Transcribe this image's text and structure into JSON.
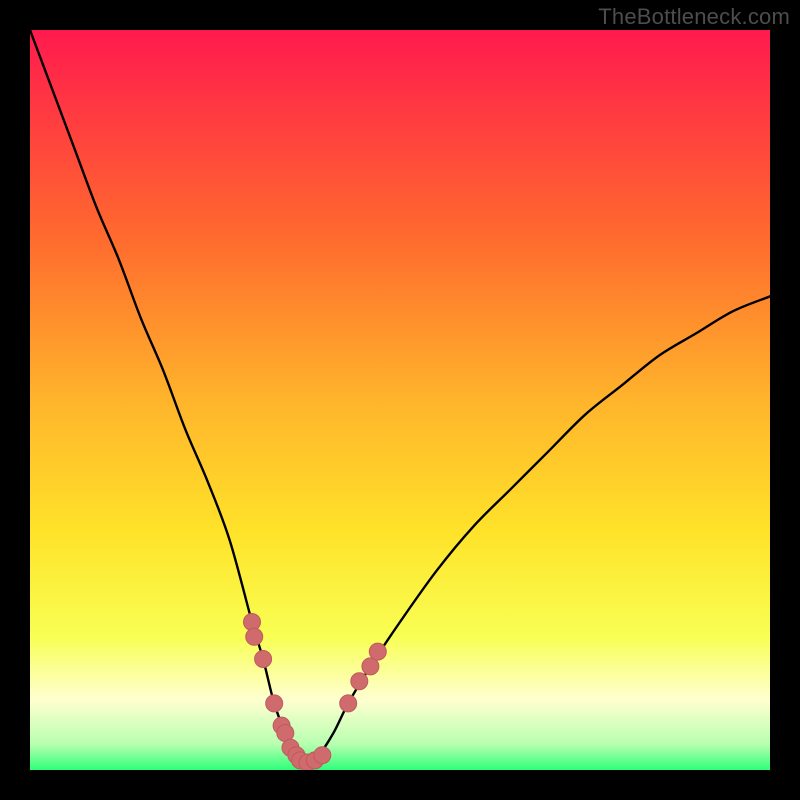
{
  "watermark": "TheBottleneck.com",
  "colors": {
    "bg": "#000000",
    "grad_top": "#ff1a4e",
    "grad_mid1": "#ff6a2e",
    "grad_mid2": "#ffb42b",
    "grad_mid3": "#ffe32a",
    "grad_low": "#f8ff54",
    "grad_pale": "#ffffd0",
    "grad_bottom": "#2fff7a",
    "curve": "#000000",
    "marker_fill": "#cf6a6d",
    "marker_stroke": "#c05a5d"
  },
  "chart_data": {
    "type": "line",
    "title": "",
    "xlabel": "",
    "ylabel": "",
    "xlim": [
      0,
      100
    ],
    "ylim": [
      0,
      100
    ],
    "series": [
      {
        "name": "bottleneck-curve",
        "x": [
          0,
          3,
          6,
          9,
          12,
          15,
          18,
          21,
          24,
          27,
          30,
          31.5,
          33,
          34.5,
          36,
          37.5,
          39,
          41,
          43,
          46,
          50,
          55,
          60,
          65,
          70,
          75,
          80,
          85,
          90,
          95,
          100
        ],
        "y": [
          100,
          92,
          84,
          76,
          69,
          61,
          54,
          46,
          39,
          31,
          20,
          15,
          9,
          5,
          2,
          1,
          2,
          5,
          9,
          14,
          20,
          27,
          33,
          38,
          43,
          48,
          52,
          56,
          59,
          62,
          64
        ]
      }
    ],
    "minimum_x": 37.5,
    "markers_left": [
      {
        "x": 30.0,
        "y": 20
      },
      {
        "x": 30.3,
        "y": 18
      },
      {
        "x": 31.5,
        "y": 15
      },
      {
        "x": 33.0,
        "y": 9
      },
      {
        "x": 34.0,
        "y": 6
      },
      {
        "x": 34.5,
        "y": 5
      },
      {
        "x": 35.2,
        "y": 3
      },
      {
        "x": 36.0,
        "y": 2
      }
    ],
    "markers_bottom": [
      {
        "x": 36.5,
        "y": 1.3
      },
      {
        "x": 37.5,
        "y": 1
      },
      {
        "x": 38.5,
        "y": 1.3
      },
      {
        "x": 39.5,
        "y": 2
      }
    ],
    "markers_right": [
      {
        "x": 43.0,
        "y": 9
      },
      {
        "x": 44.5,
        "y": 12
      },
      {
        "x": 46.0,
        "y": 14
      },
      {
        "x": 47.0,
        "y": 16
      }
    ]
  }
}
